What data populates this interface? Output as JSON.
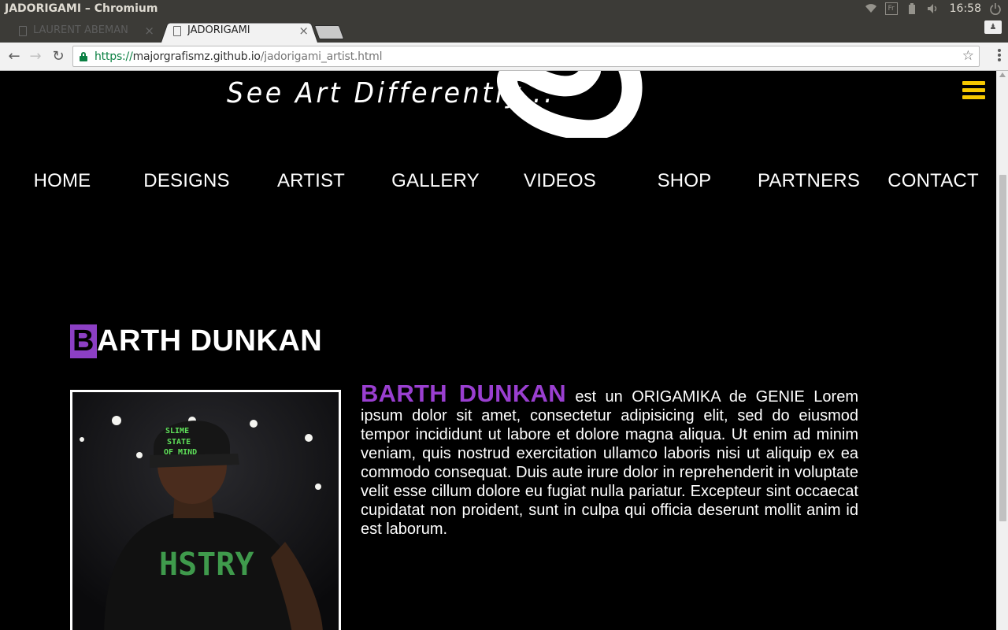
{
  "window": {
    "title": "JADORIGAMI – Chromium",
    "clock": "16:58"
  },
  "tabs": [
    {
      "label": "LAURENT ABEMAN"
    },
    {
      "label": "JADORIGAMI"
    }
  ],
  "tab_close_glyph": "×",
  "address_bar": {
    "scheme": "https://",
    "host": "majorgrafismz.github.io",
    "path": "/jadorigami_artist.html"
  },
  "toolbar": {
    "back_glyph": "←",
    "forward_glyph": "→",
    "reload_glyph": "↻",
    "star_glyph": "☆"
  },
  "header": {
    "tagline": "See Art Differently..."
  },
  "nav": {
    "items": [
      {
        "label": "HOME"
      },
      {
        "label": "DESIGNS"
      },
      {
        "label": "ARTIST"
      },
      {
        "label": "GALLERY"
      },
      {
        "label": "VIDEOS"
      },
      {
        "label": "SHOP"
      },
      {
        "label": "PARTNERS"
      },
      {
        "label": "CONTACT"
      }
    ]
  },
  "artist": {
    "heading_initial": "B",
    "heading_rest": "ARTH DUNKAN",
    "bio_name": "BARTH DUNKAN",
    "bio_text": "est un ORIGAMIKA de GENIE Lorem ipsum dolor sit amet, consectetur adipisicing elit, sed do eiusmod tempor incididunt ut labore et dolore magna aliqua. Ut enim ad minim veniam, quis nostrud exercitation ullamco laboris nisi ut aliquip ex ea commodo consequat. Duis aute irure dolor in reprehenderit in voluptate velit esse cillum dolore eu fugiat nulla pariatur. Excepteur sint occaecat cupidatat non proident, sunt in culpa qui officia deserunt mollit anim id est laborum.",
    "photo": {
      "cap_text_1": "SLIME",
      "cap_text_2": "STATE",
      "cap_text_3": "OF MIND",
      "shirt_text": "HSTRY"
    }
  },
  "colors": {
    "accent_purple": "#9a3fd0",
    "menu_yellow": "#f5c800",
    "page_bg": "#000000",
    "shirt_green": "#3f9a4c",
    "cap_green": "#5fe05a"
  },
  "icons": {
    "tab": "document-icon",
    "lock": "secure-lock-icon",
    "bookmark": "star-icon",
    "menu": "hamburger-menu-icon"
  }
}
